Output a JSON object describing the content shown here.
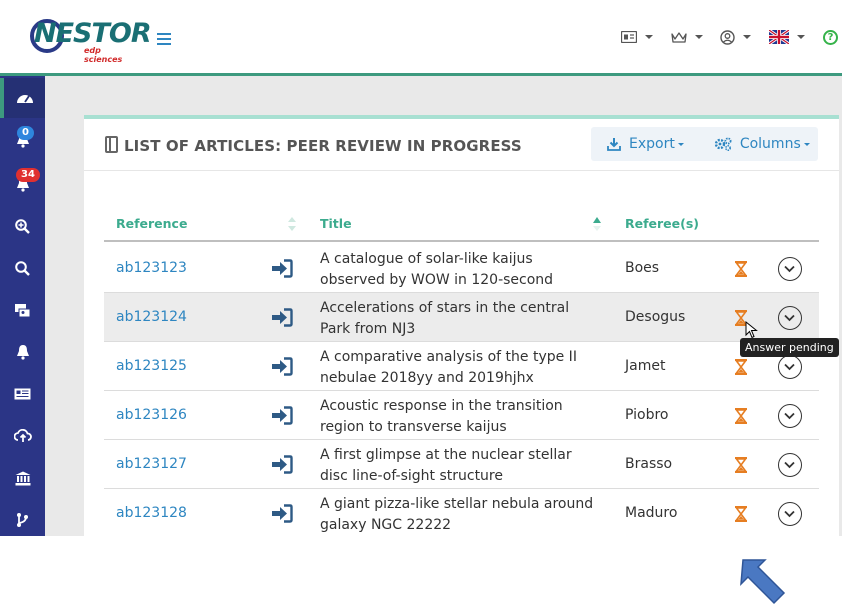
{
  "header": {
    "logo_text": "NESTOR",
    "logo_sub": "edp sciences"
  },
  "sidebar": {
    "items": [
      {
        "icon": "dashboard-icon"
      },
      {
        "icon": "bell-icon",
        "badge": "0"
      },
      {
        "icon": "bell-alert-icon",
        "badge": "34"
      },
      {
        "icon": "zoom-in-icon"
      },
      {
        "icon": "search-icon"
      },
      {
        "icon": "user-card-icon"
      },
      {
        "icon": "notification-icon"
      },
      {
        "icon": "newspaper-icon"
      },
      {
        "icon": "cloud-upload-icon"
      },
      {
        "icon": "institution-icon"
      },
      {
        "icon": "branch-icon"
      }
    ]
  },
  "card": {
    "title": "LIST OF ARTICLES: PEER REVIEW IN PROGRESS",
    "export_label": "Export",
    "columns_label": "Columns"
  },
  "table": {
    "headers": {
      "reference": "Reference",
      "title": "Title",
      "referees": "Referee(s)"
    },
    "rows": [
      {
        "reference": "ab123123",
        "title": "A catalogue of solar-like kaijus observed by WOW in 120-second cadence",
        "referee": "Boes"
      },
      {
        "reference": "ab123124",
        "title": "Accelerations of stars in the central Park from NJ3",
        "referee": "Desogus"
      },
      {
        "reference": "ab123125",
        "title": "A comparative analysis of the type II nebulae 2018yy and 2019hjhx",
        "referee": "Jamet"
      },
      {
        "reference": "ab123126",
        "title": "Acoustic response in the transition region to transverse kaijus",
        "referee": "Piobro"
      },
      {
        "reference": "ab123127",
        "title": "A first glimpse at the nuclear stellar disc line-of-sight structure",
        "referee": "Brasso"
      },
      {
        "reference": "ab123128",
        "title": "A giant pizza-like stellar nebula around galaxy NGC 22222",
        "referee": "Maduro"
      }
    ]
  },
  "tooltip": "Answer pending",
  "colors": {
    "sidebar": "#2b3586",
    "accent": "#3d9a7f",
    "link": "#2e86c1",
    "hourglass": "#e67e22"
  }
}
